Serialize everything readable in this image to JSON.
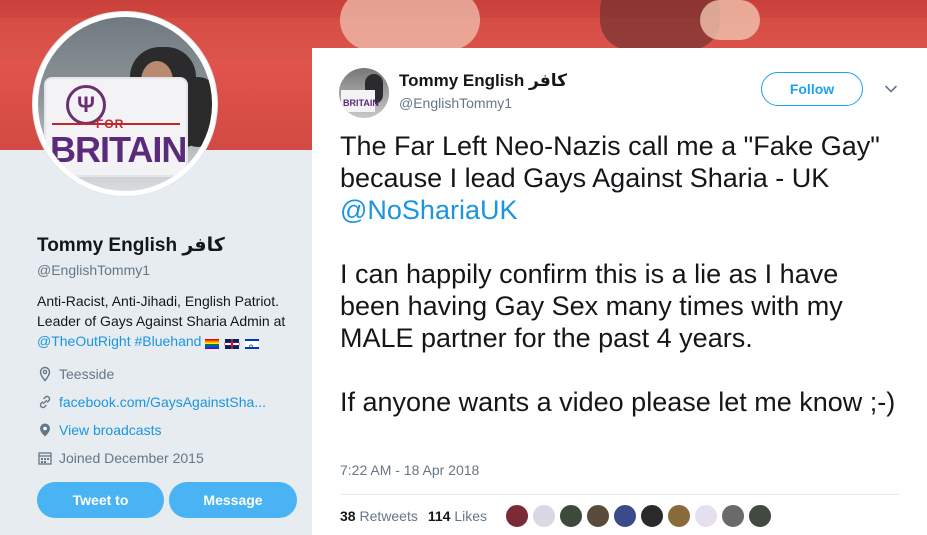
{
  "profile": {
    "name": "Tommy English كافر",
    "handle": "@EnglishTommy1",
    "bio_line1": "Anti-Racist, Anti-Jihadi, English Patriot.",
    "bio_line2": "Leader of Gays Against Sharia Admin at",
    "bio_link1": "@TheOutRight",
    "bio_link2": "#Bluehand",
    "location": "Teesside",
    "website": "facebook.com/GaysAgainstSha...",
    "broadcasts": "View broadcasts",
    "joined": "Joined December 2015",
    "avatar_for": "FOR",
    "avatar_britain": "BRITAIN"
  },
  "buttons": {
    "tweet_to": "Tweet to",
    "message": "Message"
  },
  "tweet": {
    "author_name": "Tommy English كافر",
    "author_handle": "@EnglishTommy1",
    "avatar_text": "BRITAIN",
    "follow_label": "Follow",
    "text_p1": "The Far Left Neo-Nazis call me a \"Fake Gay\" because I lead Gays Against Sharia - UK",
    "text_mention": "@NoShariaUK",
    "text_p2": "I can happily confirm this is a lie as I have been having Gay Sex many times with my MALE partner for the past 4 years.",
    "text_p3": "If anyone wants a video please let me know ;-)",
    "timestamp": "7:22 AM - 18 Apr 2018",
    "retweets_count": "38",
    "retweets_label": "Retweets",
    "likes_count": "114",
    "likes_label": "Likes"
  },
  "colors": {
    "accent": "#1da1f2",
    "button_fill": "#4ab3f4",
    "banner": "#d24a43"
  },
  "likers": [
    {
      "name": "liker-1",
      "color": "#7a2b35"
    },
    {
      "name": "liker-2",
      "color": "#d9d9e6"
    },
    {
      "name": "liker-3",
      "color": "#3c4a3a"
    },
    {
      "name": "liker-4",
      "color": "#5a4a3a"
    },
    {
      "name": "liker-5",
      "color": "#3b4a8a"
    },
    {
      "name": "liker-6",
      "color": "#2a2a2a"
    },
    {
      "name": "liker-7",
      "color": "#8a6a3a"
    },
    {
      "name": "liker-8",
      "color": "#e6dff0"
    },
    {
      "name": "liker-9",
      "color": "#6a6a6a"
    },
    {
      "name": "liker-10",
      "color": "#404a40"
    }
  ]
}
